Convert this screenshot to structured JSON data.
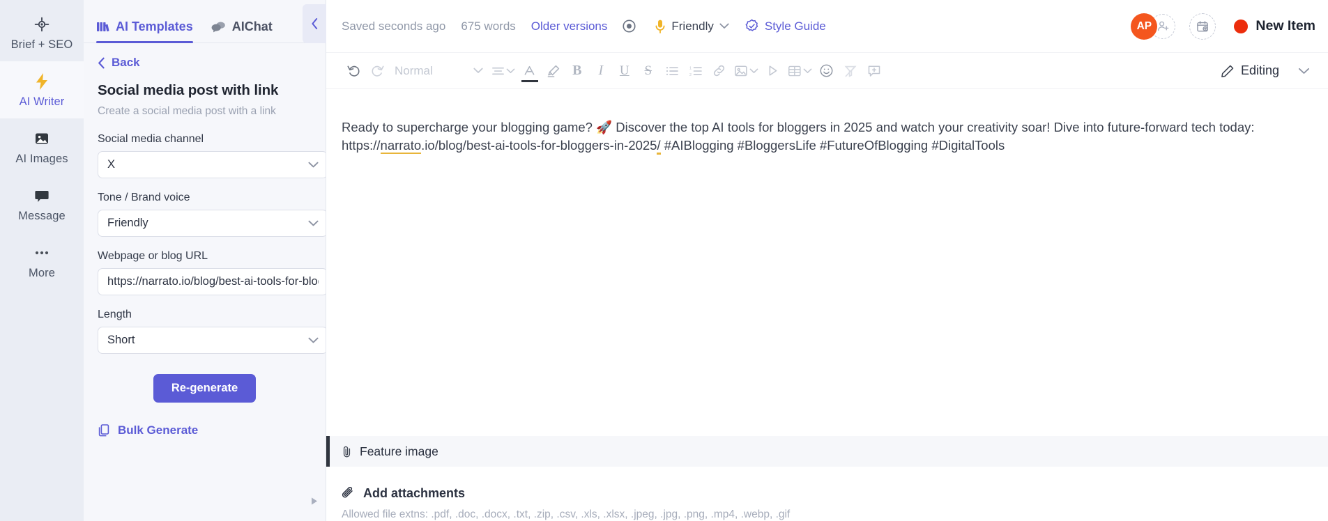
{
  "rail": {
    "items": [
      {
        "label": "Brief + SEO",
        "icon": "target-icon",
        "active": false
      },
      {
        "label": "AI Writer",
        "icon": "bolt-icon",
        "active": true
      },
      {
        "label": "AI Images",
        "icon": "image-icon",
        "active": false
      },
      {
        "label": "Message",
        "icon": "chat-bubble-icon",
        "active": false
      },
      {
        "label": "More",
        "icon": "ellipsis-icon",
        "active": false
      }
    ]
  },
  "panel": {
    "tabs": [
      {
        "label": "AI Templates",
        "icon": "templates-icon",
        "active": true
      },
      {
        "label": "AIChat",
        "icon": "chat-icon",
        "active": false
      }
    ],
    "back_label": "Back",
    "template_title": "Social media post with link",
    "template_subtitle": "Create a social media post with a link",
    "fields": [
      {
        "label": "Social media channel",
        "value": "X",
        "type": "select"
      },
      {
        "label": "Tone / Brand voice",
        "value": "Friendly",
        "type": "select"
      },
      {
        "label": "Webpage or blog URL",
        "value": "https://narrato.io/blog/best-ai-tools-for-blog",
        "type": "text"
      },
      {
        "label": "Length",
        "value": "Short",
        "type": "select"
      }
    ],
    "regenerate_label": "Re-generate",
    "bulk_label": "Bulk Generate"
  },
  "topbar": {
    "saved_status": "Saved seconds ago",
    "word_count": "675 words",
    "older_versions": "Older versions",
    "eye_icon": "eye-icon",
    "voice_label": "Friendly",
    "voice_icon": "microphone-icon",
    "style_guide": "Style Guide",
    "style_guide_icon": "check-badge-icon",
    "avatar_initials": "AP",
    "invite_icon": "add-person-icon",
    "calendar_icon": "calendar-add-icon",
    "new_item_label": "New Item",
    "new_item_dot_color": "#ec2d0c",
    "avatar_color": "#f4561e"
  },
  "formatbar": {
    "undo_icon": "undo-icon",
    "redo_icon": "redo-icon",
    "paragraph_style": "Normal",
    "align_icon": "align-icon",
    "text_color_icon": "font-color-icon",
    "highlight_icon": "highlighter-icon",
    "bold_icon": "bold-icon",
    "italic_icon": "italic-icon",
    "underline_icon": "underline-icon",
    "strike_icon": "strikethrough-icon",
    "bullet_list_icon": "bullet-list-icon",
    "numbered_list_icon": "numbered-list-icon",
    "link_icon": "link-icon",
    "image_icon": "image-insert-icon",
    "video_icon": "video-play-icon",
    "table_icon": "table-icon",
    "emoji_icon": "emoji-icon",
    "clear_format_icon": "clear-formatting-icon",
    "comment_icon": "add-comment-icon",
    "mode_label": "Editing",
    "mode_icon": "pencil-icon"
  },
  "document": {
    "paragraph_pre": "Ready to supercharge your blogging game? ",
    "rocket": "🚀",
    "paragraph_mid": " Discover the top AI tools for bloggers in 2025 and watch your creativity soar! Dive into future-forward tech today: https://",
    "link_domain": "narrato",
    "link_path": ".io/blog/best-ai-tools-for-bloggers-in-2025",
    "link_slash": "/",
    "paragraph_tags": " #AIBlogging #BloggersLife #FutureOfBlogging #DigitalTools"
  },
  "bottom": {
    "feature_image_label": "Feature image",
    "feature_image_icon": "paperclip-icon",
    "add_attachments_label": "Add attachments",
    "add_attachments_icon": "paperclip-icon",
    "allowed_extensions": "Allowed file extns: .pdf, .doc, .docx, .txt, .zip, .csv, .xls, .xlsx, .jpeg, .jpg, .png, .mp4, .webp, .gif"
  }
}
